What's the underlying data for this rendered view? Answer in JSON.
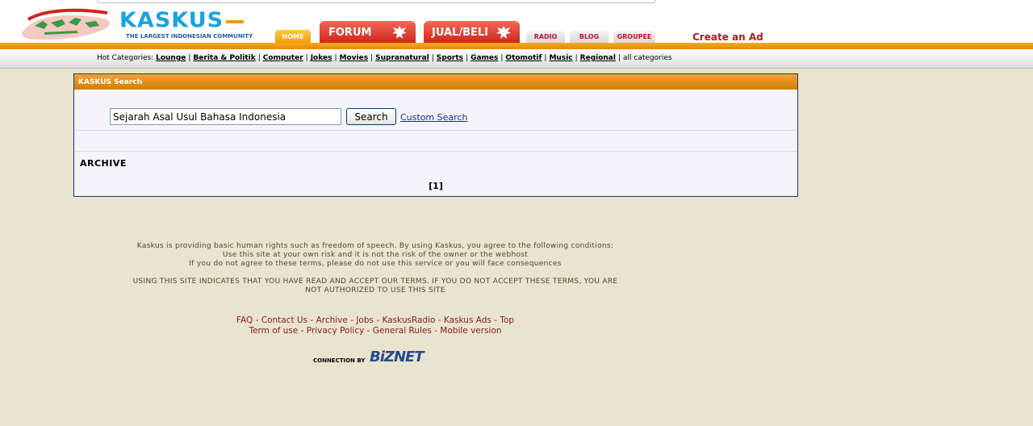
{
  "header": {
    "logo_text": "KASKUS",
    "logo_tagline": "THE LARGEST INDONESIAN COMMUNITY",
    "tabs": {
      "home": "HOME",
      "forum": "FORUM",
      "jual_beli": "JUAL/BELI",
      "radio": "RADIO",
      "blog": "BLOG",
      "groupee": "GROUPEE"
    },
    "create_ad": "Create an Ad"
  },
  "hot_categories": {
    "label": "Hot Categories:",
    "items": [
      "Lounge",
      "Berita & Politik",
      "Computer",
      "Jokes",
      "Movies",
      "Supranatural",
      "Sports",
      "Games",
      "Otomotif",
      "Music",
      "Regional"
    ],
    "all_label": "all categories"
  },
  "search_panel": {
    "title": "KASKUS Search",
    "query": "Sejarah Asal Usul Bahasa Indonesia",
    "search_label": "Search",
    "custom_search": "Custom Search",
    "archive_title": "ARCHIVE",
    "pager": "[1]"
  },
  "footer": {
    "line1": "Kaskus is providing basic human rights such as freedom of speech. By using Kaskus, you agree to the following conditions:",
    "line2": "Use this site at your own risk and it is not the risk of the owner or the webhost",
    "line3": "If you do not agree to these terms, please do not use this service or you will face consequences",
    "terms1": "USING THIS SITE INDICATES THAT YOU HAVE READ AND ACCEPT OUR TERMS. IF YOU DO NOT ACCEPT THESE TERMS, YOU ARE",
    "terms2": "NOT AUTHORIZED TO USE THIS SITE",
    "links_row1": [
      "FAQ",
      "Contact Us",
      "Archive",
      "Jobs",
      "KaskusRadio",
      "Kaskus Ads",
      "Top"
    ],
    "links_row2": [
      "Term of use",
      "Privacy Policy",
      "General Rules",
      "Mobile version"
    ],
    "connection_by": "CONNECTION BY",
    "biznet": "BiZNET"
  },
  "colors": {
    "background": "#e8e4d0",
    "orange": "#f59a0a",
    "red": "#d0251c",
    "link_red": "#8b1a1a",
    "panel_border": "#1f3a6b"
  }
}
